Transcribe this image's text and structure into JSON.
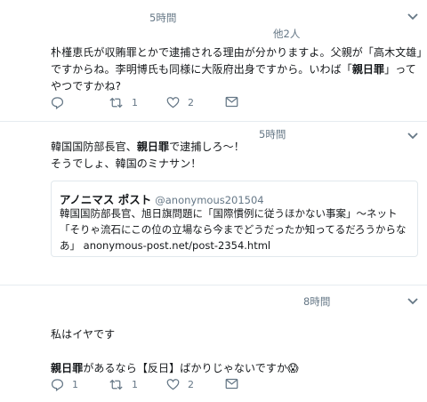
{
  "tweets": [
    {
      "time": "5時間",
      "others": "他2人",
      "text_parts": [
        "朴槿恵氏が収賄罪とかで逮捕される理由が分かりますよ。父親が「高木文雄」ですからね。李明博氏も同様に大阪府出身ですから。いわば「",
        "親日罪",
        "」ってやつですかね?"
      ],
      "actions": {
        "reply": "",
        "retweet": "1",
        "like": "2"
      }
    },
    {
      "time": "5時間",
      "line1_parts": [
        "韓国国防部長官、",
        "親日罪",
        "で逮捕しろ〜！"
      ],
      "line2": "そうでしょ、韓国のミナサン！",
      "card": {
        "name": "アノニマス ポスト",
        "handle": "@anonymous201504",
        "body": "韓国国防部長官、旭日旗問題に「国際慣例に従うほかない事案」〜ネット「そりゃ流石にこの位の立場なら今までどうだったか知ってるだろうからなあ」 anonymous-post.net/post-2354.html"
      }
    },
    {
      "time": "8時間",
      "line1": "私はイヤです",
      "line2_parts": [
        "親日罪",
        "があるなら【反日】ばかりじゃないですか😱"
      ],
      "actions": {
        "reply": "1",
        "retweet": "1",
        "like": "2"
      }
    }
  ],
  "icons": [
    "chevron-down-icon",
    "reply-icon",
    "retweet-icon",
    "like-icon",
    "dm-icon"
  ],
  "colors": {
    "meta": "#657786",
    "text": "#14171a",
    "border": "#e6ecf0"
  }
}
